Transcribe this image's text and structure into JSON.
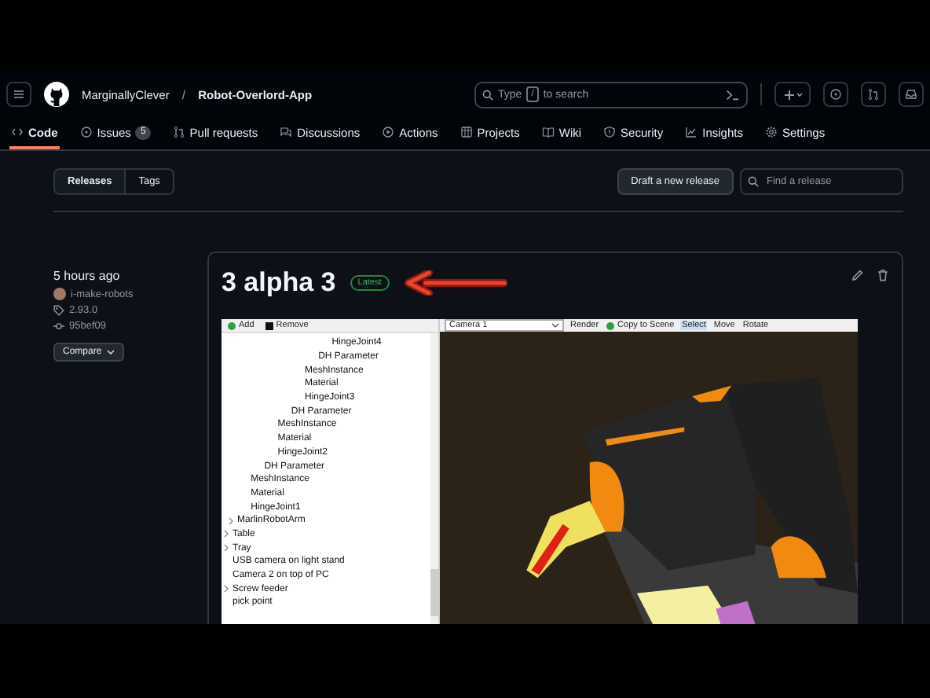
{
  "header": {
    "owner": "MarginallyClever",
    "separator": "/",
    "repo": "Robot-Overlord-App",
    "search": {
      "prefix": "Type",
      "key": "/",
      "suffix": "to search"
    }
  },
  "repo_tabs": [
    {
      "label": "Code",
      "selected": true
    },
    {
      "label": "Issues",
      "count": "5",
      "selected": false
    },
    {
      "label": "Pull requests",
      "selected": false
    },
    {
      "label": "Discussions",
      "selected": false
    },
    {
      "label": "Actions",
      "selected": false
    },
    {
      "label": "Projects",
      "selected": false
    },
    {
      "label": "Wiki",
      "selected": false
    },
    {
      "label": "Security",
      "selected": false
    },
    {
      "label": "Insights",
      "selected": false
    },
    {
      "label": "Settings",
      "selected": false
    }
  ],
  "subnav": {
    "segments": [
      {
        "label": "Releases",
        "selected": true
      },
      {
        "label": "Tags",
        "selected": false
      }
    ],
    "draft_button": "Draft a new release",
    "find": {
      "placeholder": "Find a release"
    }
  },
  "release": {
    "time": "5 hours ago",
    "author": "i-make-robots",
    "tag": "2.93.0",
    "commit": "95bef09",
    "compare_button": "Compare",
    "title": "3 alpha 3",
    "badge": "Latest",
    "screenshot": {
      "left_toolbar": [
        "Add",
        "Remove"
      ],
      "camera_select": "Camera 1",
      "right_toolbar": [
        {
          "label": "Render",
          "selected": false
        },
        {
          "label": "Copy to Scene",
          "selected": false
        },
        {
          "label": "Select",
          "selected": true
        },
        {
          "label": "Move",
          "selected": false
        },
        {
          "label": "Rotate",
          "selected": false
        }
      ],
      "tree": [
        {
          "children": [
            {
              "children": [
                {
                  "children": [
                    {
                      "children": [
                        {
                          "children": [
                            {
                              "children": [
                                {
                                  "children": [
                                    {
                                      "children": [
                                        {
                                          "label": "HingeJoint4",
                                          "kind": "item"
                                        }
                                      ]
                                    },
                                    {
                                      "label": "DH Parameter",
                                      "kind": "item"
                                    }
                                  ]
                                },
                                {
                                  "label": "MeshInstance",
                                  "kind": "item"
                                },
                                {
                                  "label": "Material",
                                  "kind": "item"
                                },
                                {
                                  "label": "HingeJoint3",
                                  "kind": "item"
                                }
                              ]
                            },
                            {
                              "label": "DH Parameter",
                              "kind": "item"
                            }
                          ]
                        },
                        {
                          "label": "MeshInstance",
                          "kind": "item"
                        },
                        {
                          "label": "Material",
                          "kind": "item"
                        },
                        {
                          "label": "HingeJoint2",
                          "kind": "item"
                        }
                      ]
                    },
                    {
                      "label": "DH Parameter",
                      "kind": "item"
                    }
                  ]
                },
                {
                  "label": "MeshInstance",
                  "kind": "item"
                },
                {
                  "label": "Material",
                  "kind": "item"
                },
                {
                  "label": "HingeJoint1",
                  "kind": "item"
                }
              ]
            },
            {
              "label": "MarlinRobotArm",
              "kind": "group"
            }
          ]
        },
        {
          "label": "Table",
          "kind": "group"
        },
        {
          "label": "Tray",
          "kind": "group"
        },
        {
          "label": "USB camera on light stand",
          "kind": "item"
        },
        {
          "label": "Camera 2 on top of PC",
          "kind": "item"
        },
        {
          "label": "Screw feeder",
          "kind": "group"
        },
        {
          "label": "pick point",
          "kind": "item"
        }
      ]
    }
  }
}
